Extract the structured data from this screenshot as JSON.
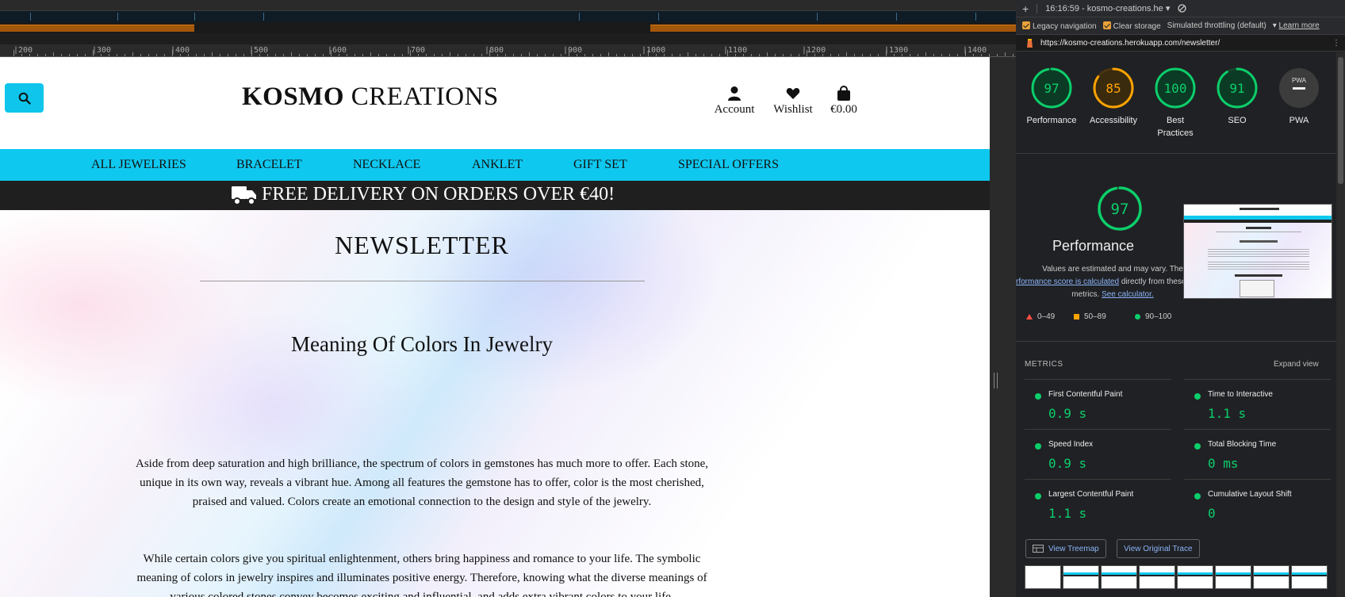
{
  "ruler": {
    "labels": [
      "|200",
      "|300",
      "|400",
      "|500",
      "|600",
      "|700",
      "|800",
      "|900",
      "|1000",
      "|1100",
      "|1200",
      "|1300",
      "|1400"
    ]
  },
  "site": {
    "brand_bold": "KOSMO",
    "brand_rest": " CREATIONS",
    "account_label": "Account",
    "wishlist_label": "Wishlist",
    "bag_total": "€0.00",
    "nav": [
      "ALL JEWELRIES",
      "BRACELET",
      "NECKLACE",
      "ANKLET",
      "GIFT SET",
      "SPECIAL OFFERS"
    ],
    "promo_text": "FREE DELIVERY ON ORDERS OVER €40!",
    "page_title": "NEWSLETTER",
    "article_title": "Meaning Of Colors In Jewelry",
    "paragraphs": [
      "Aside from deep saturation and high brilliance, the spectrum of colors in gemstones has much more to offer. Each stone, unique in its own way, reveals a vibrant hue. Among all features the gemstone has to offer, color is the most cherished, praised and valued. Colors create an emotional connection to the design and style of the jewelry.",
      "While certain colors give you spiritual enlightenment, others bring happiness and romance to your life. The symbolic meaning of colors in jewelry inspires and illuminates positive energy. Therefore, knowing what the diverse meanings of various colored stones convey becomes exciting and influential, and adds extra vibrant colors to your life."
    ]
  },
  "lighthouse": {
    "report_label": "16:16:59 - kosmo-creations.he",
    "legacy_navigation": "Legacy navigation",
    "clear_storage": "Clear storage",
    "throttling": "Simulated throttling (default)",
    "learn_more": "Learn more",
    "url": "https://kosmo-creations.herokuapp.com/newsletter/",
    "scores": [
      {
        "label": "Performance",
        "value": 97,
        "color": "#0cce6b"
      },
      {
        "label": "Accessibility",
        "value": 85,
        "color": "#ffa400"
      },
      {
        "label": "Best Practices",
        "value": 100,
        "color": "#0cce6b"
      },
      {
        "label": "SEO",
        "value": 91,
        "color": "#0cce6b"
      }
    ],
    "pwa_label": "PWA",
    "pwa_badge": "PWA",
    "big_score": 97,
    "big_title": "Performance",
    "note_line1": "Values are estimated and may vary. The",
    "note_link": "rformance score is calculated",
    "note_after_link": " directly from these",
    "note_line3_pre": "metrics. ",
    "note_calc": "See calculator.",
    "legend": [
      "0–49",
      "50–89",
      "90–100"
    ],
    "metrics_heading": "METRICS",
    "expand_view": "Expand view",
    "metrics": [
      {
        "name": "First Contentful Paint",
        "value": "0.9 s"
      },
      {
        "name": "Time to Interactive",
        "value": "1.1 s"
      },
      {
        "name": "Speed Index",
        "value": "0.9 s"
      },
      {
        "name": "Total Blocking Time",
        "value": "0 ms"
      },
      {
        "name": "Largest Contentful Paint",
        "value": "1.1 s"
      },
      {
        "name": "Cumulative Layout Shift",
        "value": "0"
      }
    ],
    "view_treemap": "View Treemap",
    "view_trace": "View Original Trace"
  }
}
